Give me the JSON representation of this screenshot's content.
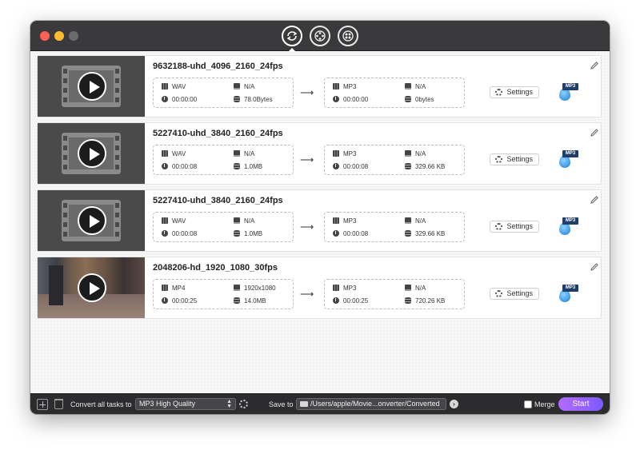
{
  "tasks": [
    {
      "title": "9632188-uhd_4096_2160_24fps",
      "thumb": "film",
      "src": {
        "format": "WAV",
        "resolution": "N/A",
        "duration": "00:00:00",
        "size": "78.0Bytes"
      },
      "dst": {
        "format": "MP3",
        "resolution": "N/A",
        "duration": "00:00:00",
        "size": "0bytes"
      },
      "settings": "Settings",
      "format_badge": "MP3"
    },
    {
      "title": "5227410-uhd_3840_2160_24fps",
      "thumb": "film",
      "src": {
        "format": "WAV",
        "resolution": "N/A",
        "duration": "00:00:08",
        "size": "1.0MB"
      },
      "dst": {
        "format": "MP3",
        "resolution": "N/A",
        "duration": "00:00:08",
        "size": "329.66 KB"
      },
      "settings": "Settings",
      "format_badge": "MP3"
    },
    {
      "title": "5227410-uhd_3840_2160_24fps",
      "thumb": "film",
      "src": {
        "format": "WAV",
        "resolution": "N/A",
        "duration": "00:00:08",
        "size": "1.0MB"
      },
      "dst": {
        "format": "MP3",
        "resolution": "N/A",
        "duration": "00:00:08",
        "size": "329.66 KB"
      },
      "settings": "Settings",
      "format_badge": "MP3"
    },
    {
      "title": "2048206-hd_1920_1080_30fps",
      "thumb": "photo",
      "src": {
        "format": "MP4",
        "resolution": "1920x1080",
        "duration": "00:00:25",
        "size": "14.0MB"
      },
      "dst": {
        "format": "MP3",
        "resolution": "N/A",
        "duration": "00:00:25",
        "size": "720.26 KB"
      },
      "settings": "Settings",
      "format_badge": "MP3"
    }
  ],
  "footer": {
    "convert_label": "Convert all tasks to",
    "preset": "MP3 High Quality",
    "save_label": "Save to",
    "save_path": "/Users/apple/Movie...onverter/Converted",
    "merge_label": "Merge",
    "start_label": "Start"
  },
  "icons": {
    "toolbar": [
      "convert-icon",
      "video-reel-icon",
      "film-reel-icon"
    ],
    "edit": "pencil-icon",
    "format": "mp3-file-icon"
  },
  "colors": {
    "titlebar": "#3a3a3c",
    "footer": "#2c2c2e",
    "start_gradient_from": "#b36bff",
    "start_gradient_to": "#7d59ff"
  }
}
